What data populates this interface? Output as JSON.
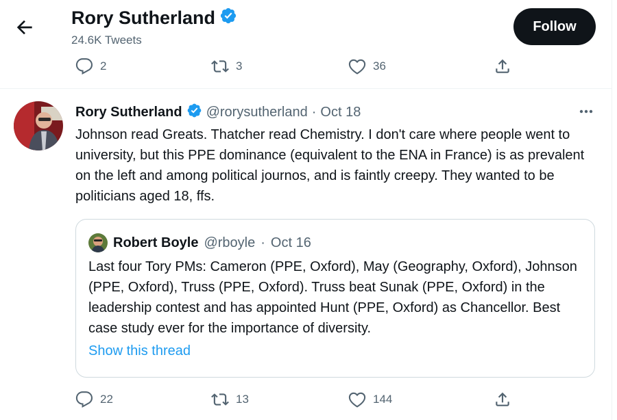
{
  "header": {
    "name": "Rory Sutherland",
    "tweet_count": "24.6K Tweets",
    "follow_label": "Follow",
    "icons": {
      "back": "back-arrow-icon",
      "verified": "verified-badge-icon"
    }
  },
  "prev_tweet_actions": {
    "replies": "2",
    "retweets": "3",
    "likes": "36"
  },
  "tweet": {
    "author_name": "Rory Sutherland",
    "handle": "@rorysutherland",
    "separator": "·",
    "date": "Oct 18",
    "text": "Johnson read Greats. Thatcher read Chemistry. I don't care where people went to university, but this PPE dominance (equivalent to the ENA in France) is as prevalent on the left and among political journos, and is faintly creepy. They wanted to be politicians aged 18, ffs.",
    "quoted": {
      "author_name": "Robert Boyle",
      "handle": "@rboyle",
      "separator": "·",
      "date": "Oct 16",
      "text": "Last four Tory PMs: Cameron (PPE, Oxford), May (Geography, Oxford), Johnson (PPE, Oxford), Truss (PPE, Oxford). Truss beat Sunak (PPE, Oxford) in the leadership contest and has appointed Hunt (PPE, Oxford) as Chancellor. Best case study ever for the importance of diversity.",
      "show_thread": "Show this thread"
    },
    "actions": {
      "replies": "22",
      "retweets": "13",
      "likes": "144"
    }
  },
  "colors": {
    "accent": "#1d9bf0",
    "text": "#0f1419",
    "muted": "#536471",
    "border": "#cfd9de"
  }
}
